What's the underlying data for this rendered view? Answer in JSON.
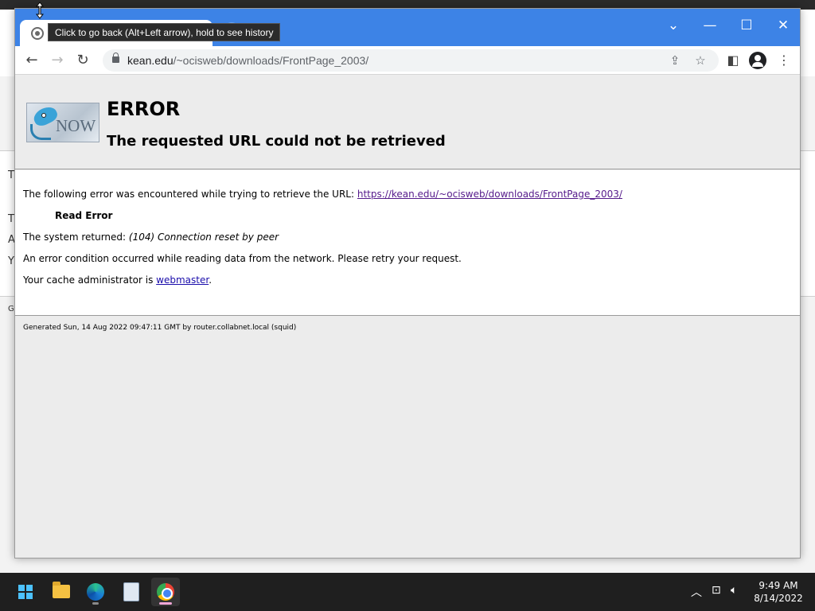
{
  "tooltip": {
    "text": "Click to go back (Alt+Left arrow), hold to see history"
  },
  "address_bar": {
    "domain": "kean.edu",
    "path": "/~ocisweb/downloads/FrontPage_2003/"
  },
  "error_page": {
    "logo_text": "NOW",
    "title": "ERROR",
    "subtitle": "The requested URL could not be retrieved",
    "intro_text": "The following error was encountered while trying to retrieve the URL:",
    "url_link": "https://kean.edu/~ocisweb/downloads/FrontPage_2003/",
    "error_name": "Read Error",
    "system_returned_label": "The system returned:",
    "system_returned_value": "(104) Connection reset by peer",
    "condition_text": "An error condition occurred while reading data from the network. Please retry your request.",
    "admin_prefix": "Your cache administrator is",
    "admin_link": "webmaster",
    "admin_suffix": ".",
    "footer": "Generated Sun, 14 Aug 2022 09:47:11 GMT by router.collabnet.local (squid)"
  },
  "background_app": {
    "letters": [
      "T",
      "T",
      "A",
      "Y",
      "G"
    ]
  },
  "taskbar": {
    "apps": [
      "start-icon",
      "file-explorer-icon",
      "edge-icon",
      "app-icon",
      "chrome-icon"
    ],
    "time": "9:49 AM",
    "date": "8/14/2022"
  }
}
